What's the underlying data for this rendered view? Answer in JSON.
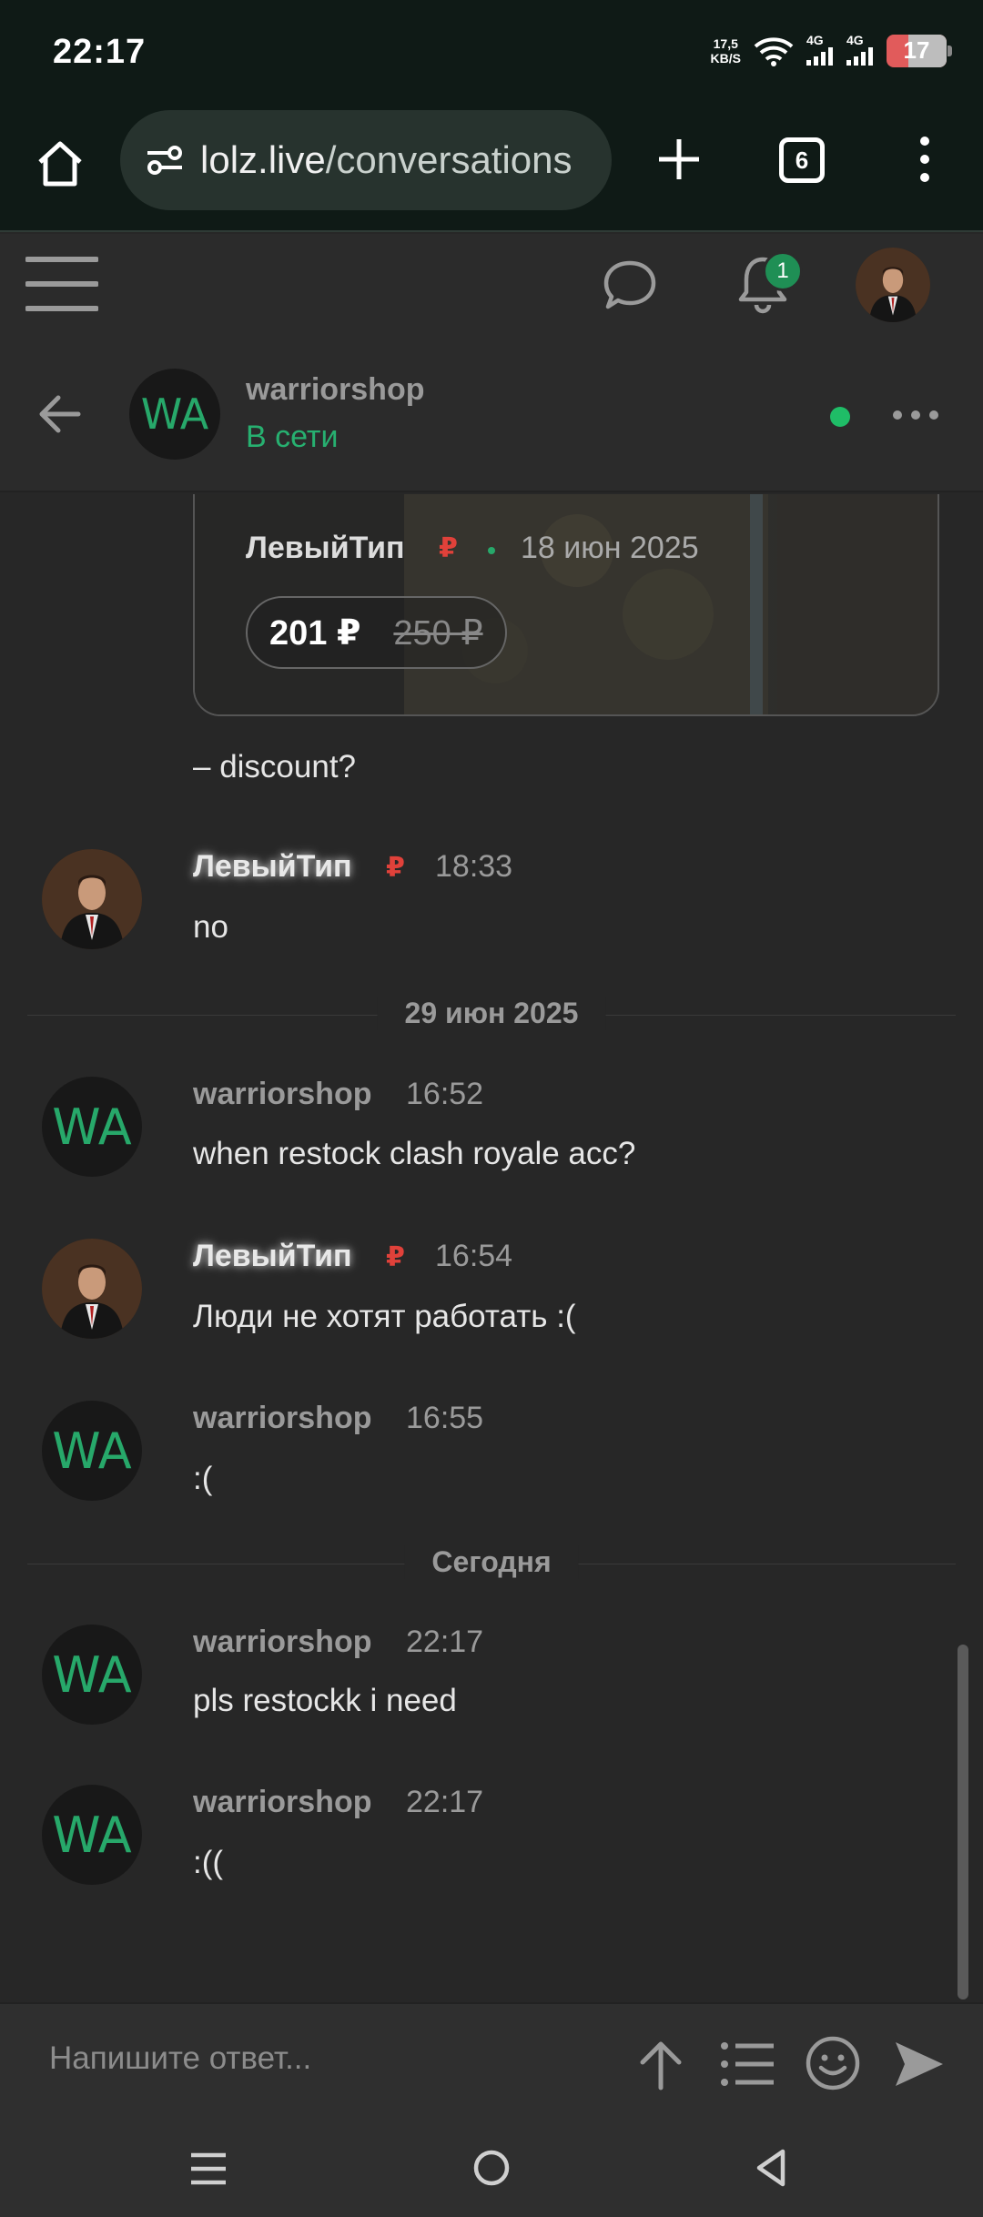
{
  "status_bar": {
    "time": "22:17",
    "net_speed_top": "17,5",
    "net_speed_unit": "KB/S",
    "signal1_label": "4G",
    "signal2_label": "4G",
    "battery": "17"
  },
  "browser": {
    "url_host": "lolz.live",
    "url_path": "/conversations",
    "tab_count": "6"
  },
  "site_header": {
    "notification_count": "1"
  },
  "conversation": {
    "name": "warriorshop",
    "status": "В сети",
    "avatar_initials": "WA"
  },
  "messages": {
    "card": {
      "seller": "ЛевыйТип",
      "date": "18 июн 2025",
      "price_now": "201 ₽",
      "price_old": "250 ₽"
    },
    "m0_text": "– discount?",
    "m1": {
      "author": "ЛевыйТип",
      "time": "18:33",
      "text": "no"
    },
    "divider1": "29 июн 2025",
    "m2": {
      "author": "warriorshop",
      "time": "16:52",
      "text": "when restock clash royale acc?"
    },
    "m3": {
      "author": "ЛевыйТип",
      "time": "16:54",
      "text": "Люди не хотят работать :("
    },
    "m4": {
      "author": "warriorshop",
      "time": "16:55",
      "text": ":("
    },
    "divider2": "Сегодня",
    "m5": {
      "author": "warriorshop",
      "time": "22:17",
      "text": "pls restockk i need"
    },
    "m6": {
      "author": "warriorshop",
      "time": "22:17",
      "text": ":(("
    }
  },
  "composer": {
    "placeholder": "Напишите ответ..."
  },
  "colors": {
    "accent_green": "#27a86a",
    "rub_red": "#e0413a",
    "background": "#272727"
  }
}
